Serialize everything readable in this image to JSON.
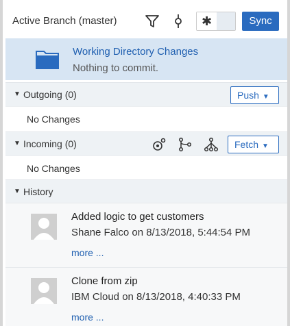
{
  "toolbar": {
    "title": "Active Branch (master)",
    "filter_icon": "filter-icon",
    "commit_icon": "git-commit-icon",
    "toggle_icon": "asterisk-icon",
    "sync_label": "Sync"
  },
  "working_directory": {
    "icon": "folder-icon",
    "title": "Working Directory Changes",
    "status": "Nothing to commit."
  },
  "outgoing": {
    "label": "Outgoing (0)",
    "button_label": "Push",
    "empty_text": "No Changes"
  },
  "incoming": {
    "label": "Incoming (0)",
    "icons": [
      "fetch-merge-icon",
      "branch-icon",
      "merge-icon"
    ],
    "button_label": "Fetch",
    "empty_text": "No Changes"
  },
  "history": {
    "label": "History",
    "commits": [
      {
        "message": "Added logic to get customers",
        "author": "Shane Falco",
        "date": "on 8/13/2018, 5:44:54 PM",
        "more": "more ..."
      },
      {
        "message": "Clone from zip",
        "author": "IBM Cloud",
        "date": "on 8/13/2018, 4:40:33 PM",
        "more": "more ..."
      }
    ]
  },
  "colors": {
    "accent": "#2a6bbf",
    "selected_row": "#d7e5f3",
    "section_header": "#eef2f5"
  }
}
